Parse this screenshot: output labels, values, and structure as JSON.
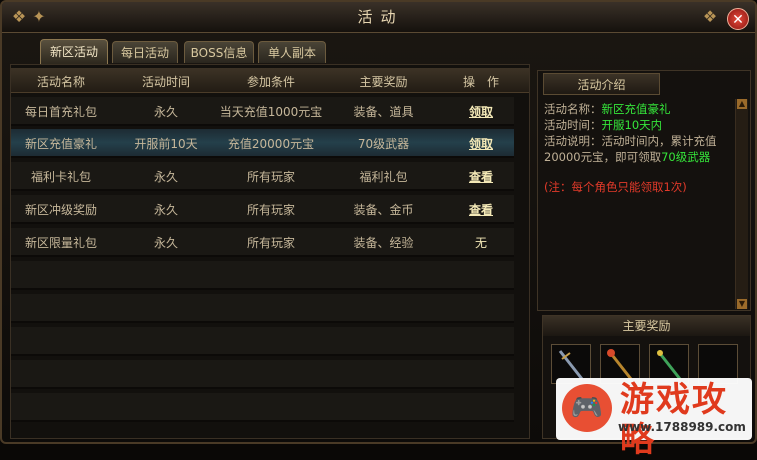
{
  "window": {
    "title": "活动",
    "close_icon": "close-icon"
  },
  "tabs": [
    {
      "label": "新区活动",
      "active": true
    },
    {
      "label": "每日活动",
      "active": false
    },
    {
      "label": "BOSS信息",
      "active": false
    },
    {
      "label": "单人副本",
      "active": false
    }
  ],
  "table": {
    "headers": [
      "活动名称",
      "活动时间",
      "参加条件",
      "主要奖励",
      "操　作"
    ],
    "rows": [
      {
        "name": "每日首充礼包",
        "time": "永久",
        "condition": "当天充值1000元宝",
        "reward": "装备、道具",
        "action": "领取"
      },
      {
        "name": "新区充值豪礼",
        "time": "开服前10天",
        "condition": "充值20000元宝",
        "reward": "70级武器",
        "action": "领取"
      },
      {
        "name": "福利卡礼包",
        "time": "永久",
        "condition": "所有玩家",
        "reward": "福利礼包",
        "action": "查看"
      },
      {
        "name": "新区冲级奖励",
        "time": "永久",
        "condition": "所有玩家",
        "reward": "装备、金币",
        "action": "查看"
      },
      {
        "name": "新区限量礼包",
        "time": "永久",
        "condition": "所有玩家",
        "reward": "装备、经验",
        "action": "无"
      }
    ]
  },
  "intro": {
    "header": "活动介绍",
    "name_label": "活动名称：",
    "name_value": "新区充值豪礼",
    "time_label": "活动时间：",
    "time_value": "开服10天内",
    "desc_label": "活动说明：活动时间内，累计充值20000元宝，即可领取",
    "desc_value": "70级武器",
    "note": "(注：每个角色只能领取1次)"
  },
  "rewards": {
    "header": "主要奖励"
  },
  "watermark": {
    "text": "游戏攻略",
    "url": "www.1788989.com"
  }
}
